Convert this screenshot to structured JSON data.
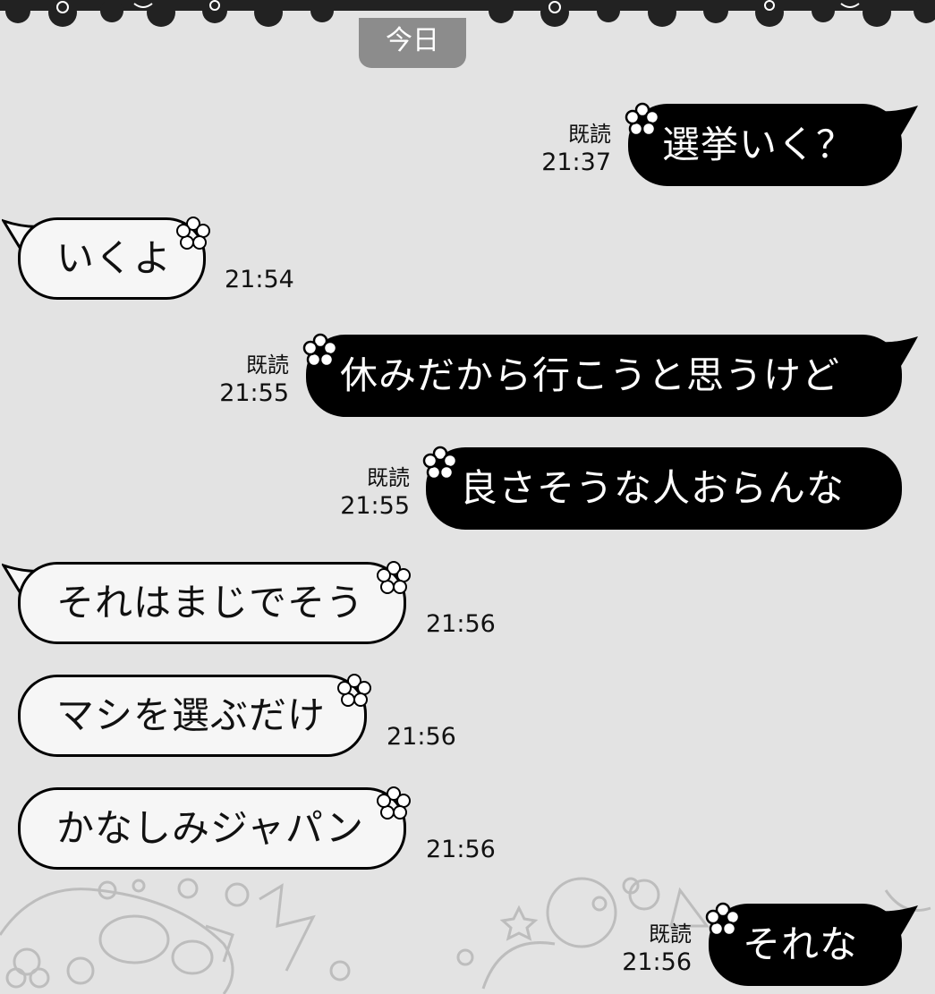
{
  "date_label": "今日",
  "messages": [
    {
      "side": "sent",
      "text": "選挙いく？",
      "read": "既読",
      "time": "21:37"
    },
    {
      "side": "received",
      "text": "いくよ",
      "time": "21:54"
    },
    {
      "side": "sent",
      "text": "休みだから行こうと思うけど",
      "read": "既読",
      "time": "21:55"
    },
    {
      "side": "sent",
      "text": "良さそうな人おらんな",
      "read": "既読",
      "time": "21:55"
    },
    {
      "side": "received",
      "text": "それはまじでそう",
      "time": "21:56"
    },
    {
      "side": "received",
      "text": "マシを選ぶだけ",
      "time": "21:56"
    },
    {
      "side": "received",
      "text": "かなしみジャパン",
      "time": "21:56"
    },
    {
      "side": "sent",
      "text": "それな",
      "read": "既読",
      "time": "21:56"
    }
  ],
  "colors": {
    "background": "#e3e3e3",
    "sent_bubble": "#000000",
    "received_bubble": "#f6f6f6",
    "date_pill": "#8c8c8c"
  },
  "icons": [
    "flower-icon",
    "doodle-pattern"
  ]
}
